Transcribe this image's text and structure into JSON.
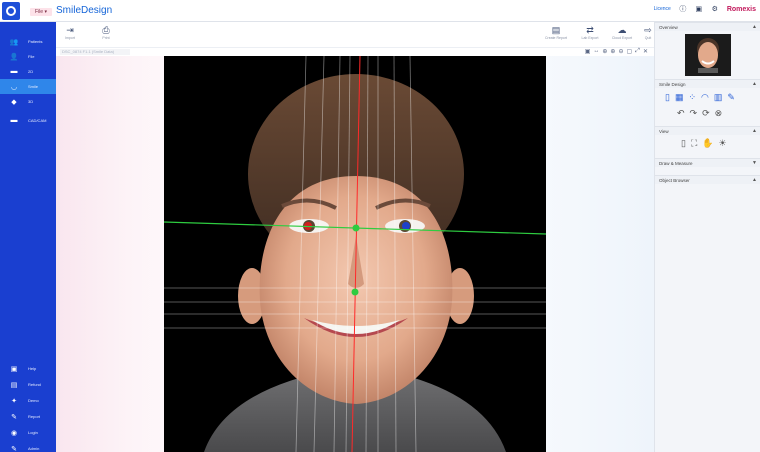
{
  "header": {
    "file_label": "File",
    "app_title": "SmileDesign",
    "license_label": "Licence",
    "brand": "Romexis",
    "colors": {
      "accent": "#1565d8",
      "brand": "#c2185b",
      "sidebar": "#1a3fd0"
    }
  },
  "sidebar": {
    "items": [
      {
        "icon": "patients-icon",
        "glyph": "👥",
        "label": "Patients",
        "active": false
      },
      {
        "icon": "file-icon",
        "glyph": "👤",
        "label": "File",
        "active": false
      },
      {
        "icon": "2d-icon",
        "glyph": "▬",
        "label": "2D",
        "active": false
      },
      {
        "icon": "smile-icon",
        "glyph": "◡",
        "label": "Smile",
        "active": true
      },
      {
        "icon": "3d-icon",
        "glyph": "◆",
        "label": "3D",
        "active": false
      },
      {
        "icon": "cadcam-icon",
        "glyph": "▬",
        "label": "CAD/CAM",
        "active": false
      }
    ],
    "bottom_items": [
      {
        "icon": "help-icon",
        "glyph": "▣",
        "label": "Help"
      },
      {
        "icon": "refund-icon",
        "glyph": "▤",
        "label": "Refund"
      },
      {
        "icon": "demo-icon",
        "glyph": "✦",
        "label": "Demo"
      },
      {
        "icon": "report-icon",
        "glyph": "✎",
        "label": "Report"
      },
      {
        "icon": "login-icon",
        "glyph": "◉",
        "label": "Login"
      },
      {
        "icon": "admin-icon",
        "glyph": "✎",
        "label": "Admin"
      }
    ]
  },
  "toolbar": {
    "left": [
      {
        "icon": "import-icon",
        "glyph": "⇥",
        "label": "Import"
      },
      {
        "icon": "print-icon",
        "glyph": "⎙",
        "label": "Print"
      }
    ],
    "right": [
      {
        "icon": "create-report-icon",
        "glyph": "▤",
        "label": "Create Report"
      },
      {
        "icon": "lab-export-icon",
        "glyph": "⇄",
        "label": "Lab Export"
      },
      {
        "icon": "cloud-export-icon",
        "glyph": "☁",
        "label": "Cloud Export"
      },
      {
        "icon": "quit-icon",
        "glyph": "⇨",
        "label": "Quit"
      }
    ]
  },
  "filebar": {
    "filename": "DSC_0874 F1.1 (Smile Data)",
    "view_tools": [
      "▣",
      "↔",
      "⊕",
      "⊕",
      "⊖",
      "▢",
      "⤢",
      "✕"
    ]
  },
  "right_panel": {
    "sections": [
      {
        "key": "overview",
        "label": "Overview",
        "arrow": "▲"
      },
      {
        "key": "smile_design",
        "label": "Smile Design",
        "arrow": "▲"
      },
      {
        "key": "view",
        "label": "View",
        "arrow": "▲"
      },
      {
        "key": "draw_measure",
        "label": "Draw & Measure",
        "arrow": "▼"
      },
      {
        "key": "object_browser",
        "label": "Object Browser",
        "arrow": "▲"
      }
    ],
    "smile_tools_row1": [
      {
        "icon": "tooth-tool-icon",
        "glyph": "▯"
      },
      {
        "icon": "grid-tool-icon",
        "glyph": "▦"
      },
      {
        "icon": "dots-tool-icon",
        "glyph": "⁘"
      },
      {
        "icon": "lips-tool-icon",
        "glyph": "◠"
      },
      {
        "icon": "teeth-tool-icon",
        "glyph": "▥"
      },
      {
        "icon": "pen-tool-icon",
        "glyph": "✎"
      }
    ],
    "smile_tools_row2": [
      {
        "icon": "undo-icon",
        "glyph": "↶"
      },
      {
        "icon": "redo-icon",
        "glyph": "↷"
      },
      {
        "icon": "rotate-icon",
        "glyph": "⟳"
      },
      {
        "icon": "reset-icon",
        "glyph": "⊗"
      }
    ],
    "view_tools": [
      {
        "icon": "tooth-view-icon",
        "glyph": "▯"
      },
      {
        "icon": "fit-view-icon",
        "glyph": "⛶"
      },
      {
        "icon": "hand-view-icon",
        "glyph": "✋"
      },
      {
        "icon": "brightness-view-icon",
        "glyph": "☀"
      }
    ]
  }
}
